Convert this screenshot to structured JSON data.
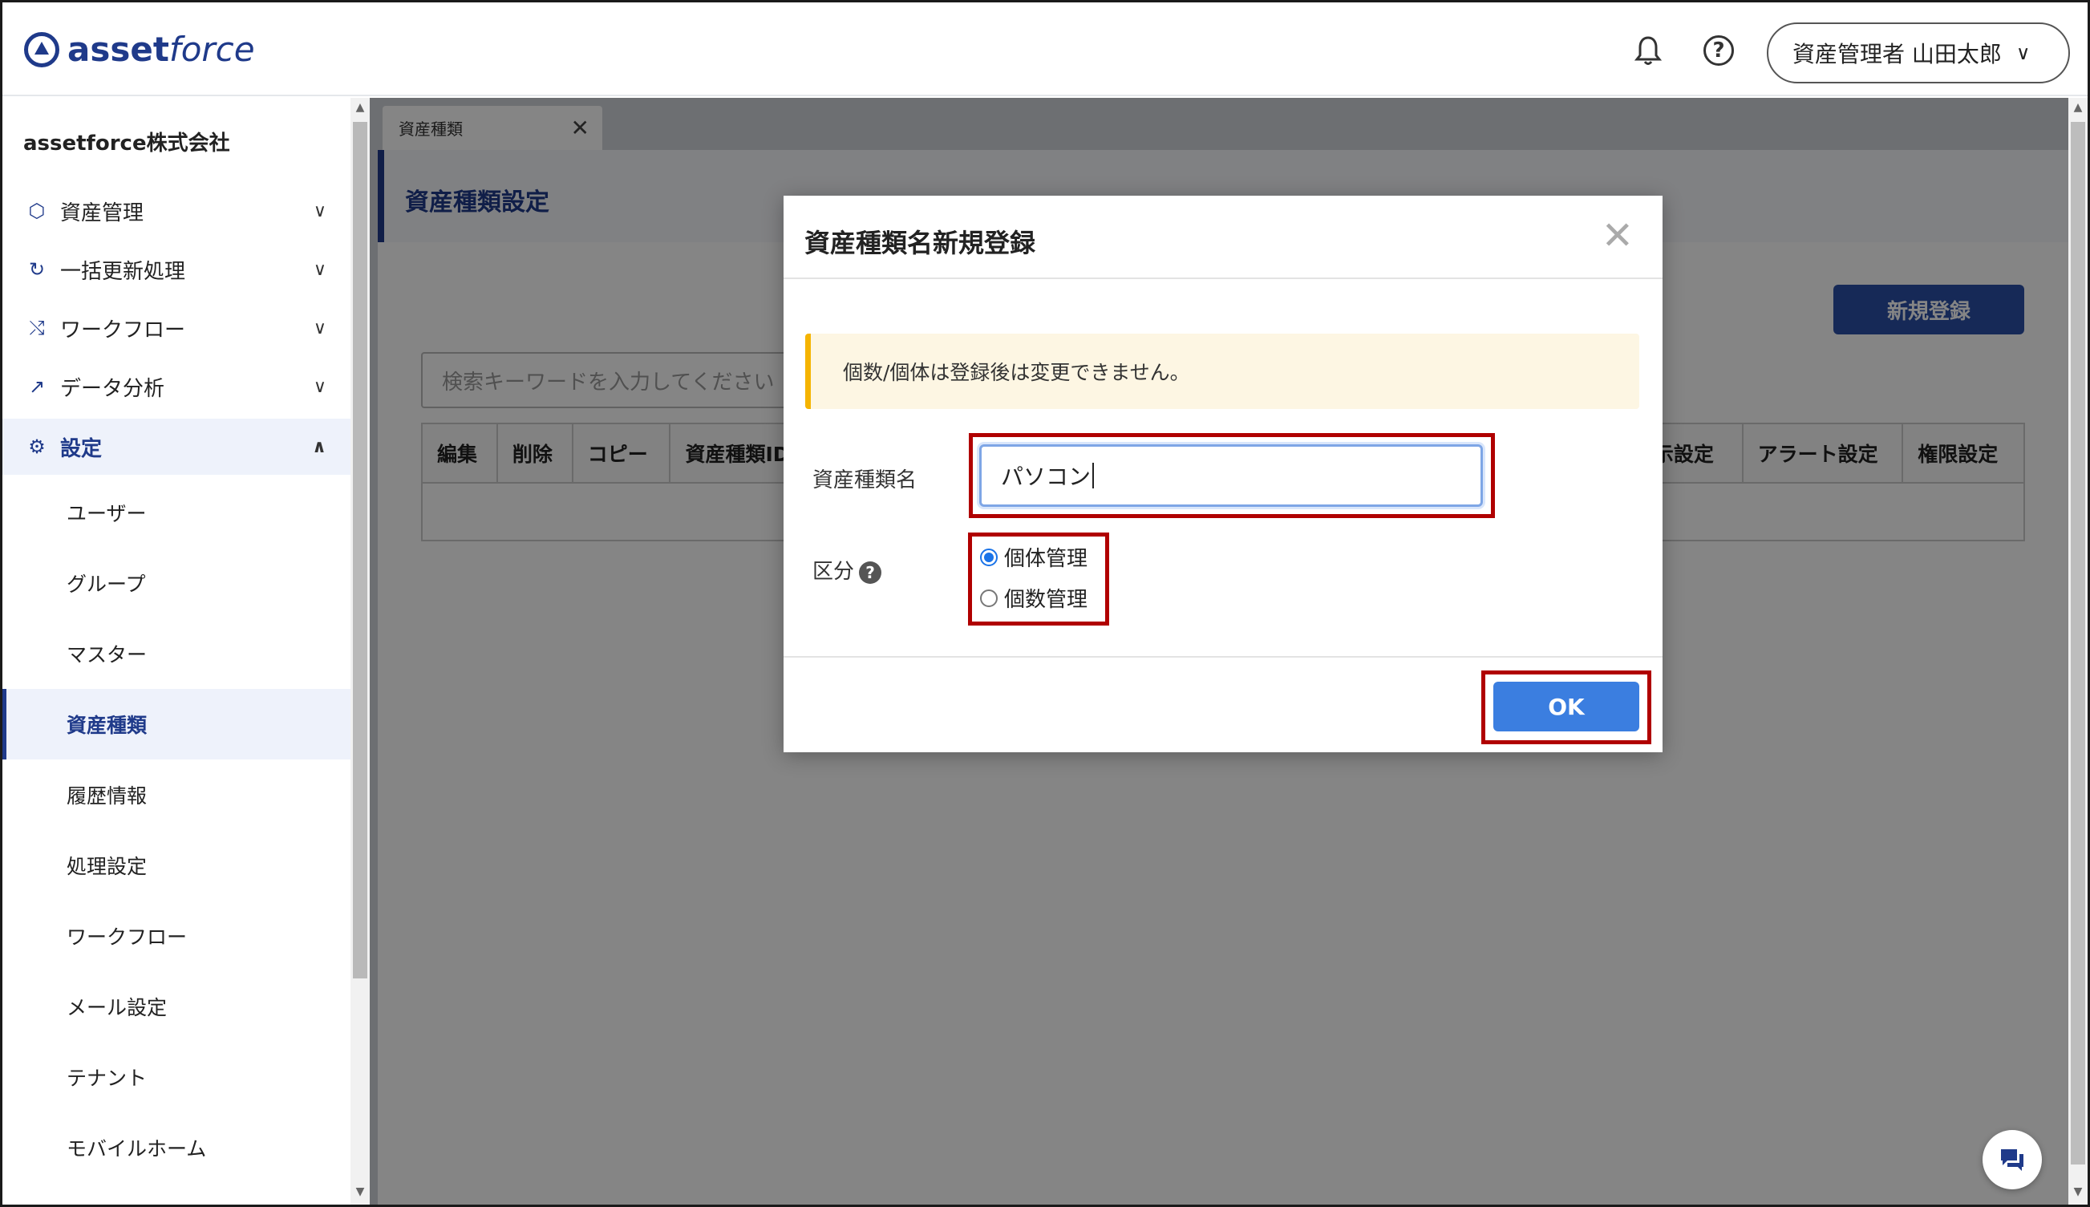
{
  "header": {
    "logo_bold": "asset",
    "logo_italic": "force",
    "user_label": "資産管理者 山田太郎"
  },
  "sidebar": {
    "company": "assetforce株式会社",
    "sections": [
      {
        "label": "資産管理",
        "icon": "cube-icon"
      },
      {
        "label": "一括更新処理",
        "icon": "refresh-icon"
      },
      {
        "label": "ワークフロー",
        "icon": "workflow-icon"
      },
      {
        "label": "データ分析",
        "icon": "analytics-icon"
      },
      {
        "label": "設定",
        "icon": "gear-icon"
      }
    ],
    "settings_items": [
      "ユーザー",
      "グループ",
      "マスター",
      "資産種類",
      "履歴情報",
      "処理設定",
      "ワークフロー",
      "メール設定",
      "テナント",
      "モバイルホーム"
    ],
    "current_item": "資産種類"
  },
  "tabs": [
    {
      "label": "資産種類"
    }
  ],
  "page": {
    "title": "資産種類設定",
    "new_button": "新規登録",
    "search_placeholder": "検索キーワードを入力してください",
    "columns": [
      "編集",
      "削除",
      "コピー",
      "資産種類ID",
      "示設定",
      "アラート設定",
      "権限設定"
    ]
  },
  "modal": {
    "title": "資産種類名新規登録",
    "notice": "個数/個体は登録後は変更できません。",
    "name_label": "資産種類名",
    "name_value": "パソコン",
    "category_label": "区分",
    "options": [
      {
        "label": "個体管理",
        "checked": true
      },
      {
        "label": "個数管理",
        "checked": false
      }
    ],
    "ok_label": "OK"
  },
  "colors": {
    "brand": "#1f3a8a",
    "primary_button": "#3b7ee0",
    "highlight_frame": "#b00000",
    "notice_accent": "#f5b400"
  }
}
